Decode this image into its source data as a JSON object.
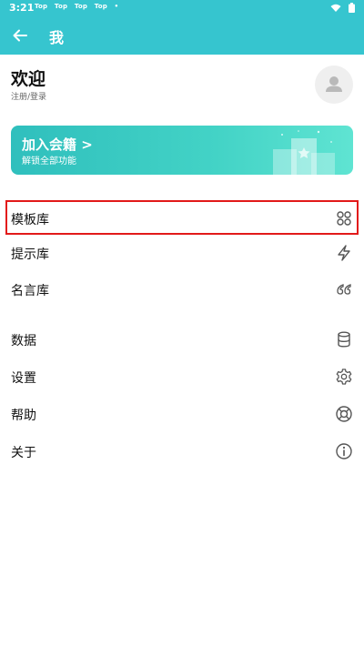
{
  "status_bar": {
    "time": "3:21",
    "notifications": [
      "Top",
      "Top",
      "Top",
      "Top",
      "•"
    ]
  },
  "app_bar": {
    "title": "我"
  },
  "profile": {
    "welcome": "欢迎",
    "register_login": "注册/登录"
  },
  "banner": {
    "title": "加入会籍 >",
    "subtitle": "解锁全部功能"
  },
  "menu": {
    "items": [
      {
        "label": "模板库",
        "icon": "grid-icon"
      },
      {
        "label": "提示库",
        "icon": "lightning-icon"
      },
      {
        "label": "名言库",
        "icon": "quote-icon"
      },
      {
        "label": "数据",
        "icon": "database-icon"
      },
      {
        "label": "设置",
        "icon": "gear-icon"
      },
      {
        "label": "帮助",
        "icon": "lifebuoy-icon"
      },
      {
        "label": "关于",
        "icon": "info-icon"
      }
    ]
  },
  "colors": {
    "primary": "#36c5cf",
    "highlight": "#e21a1a"
  }
}
